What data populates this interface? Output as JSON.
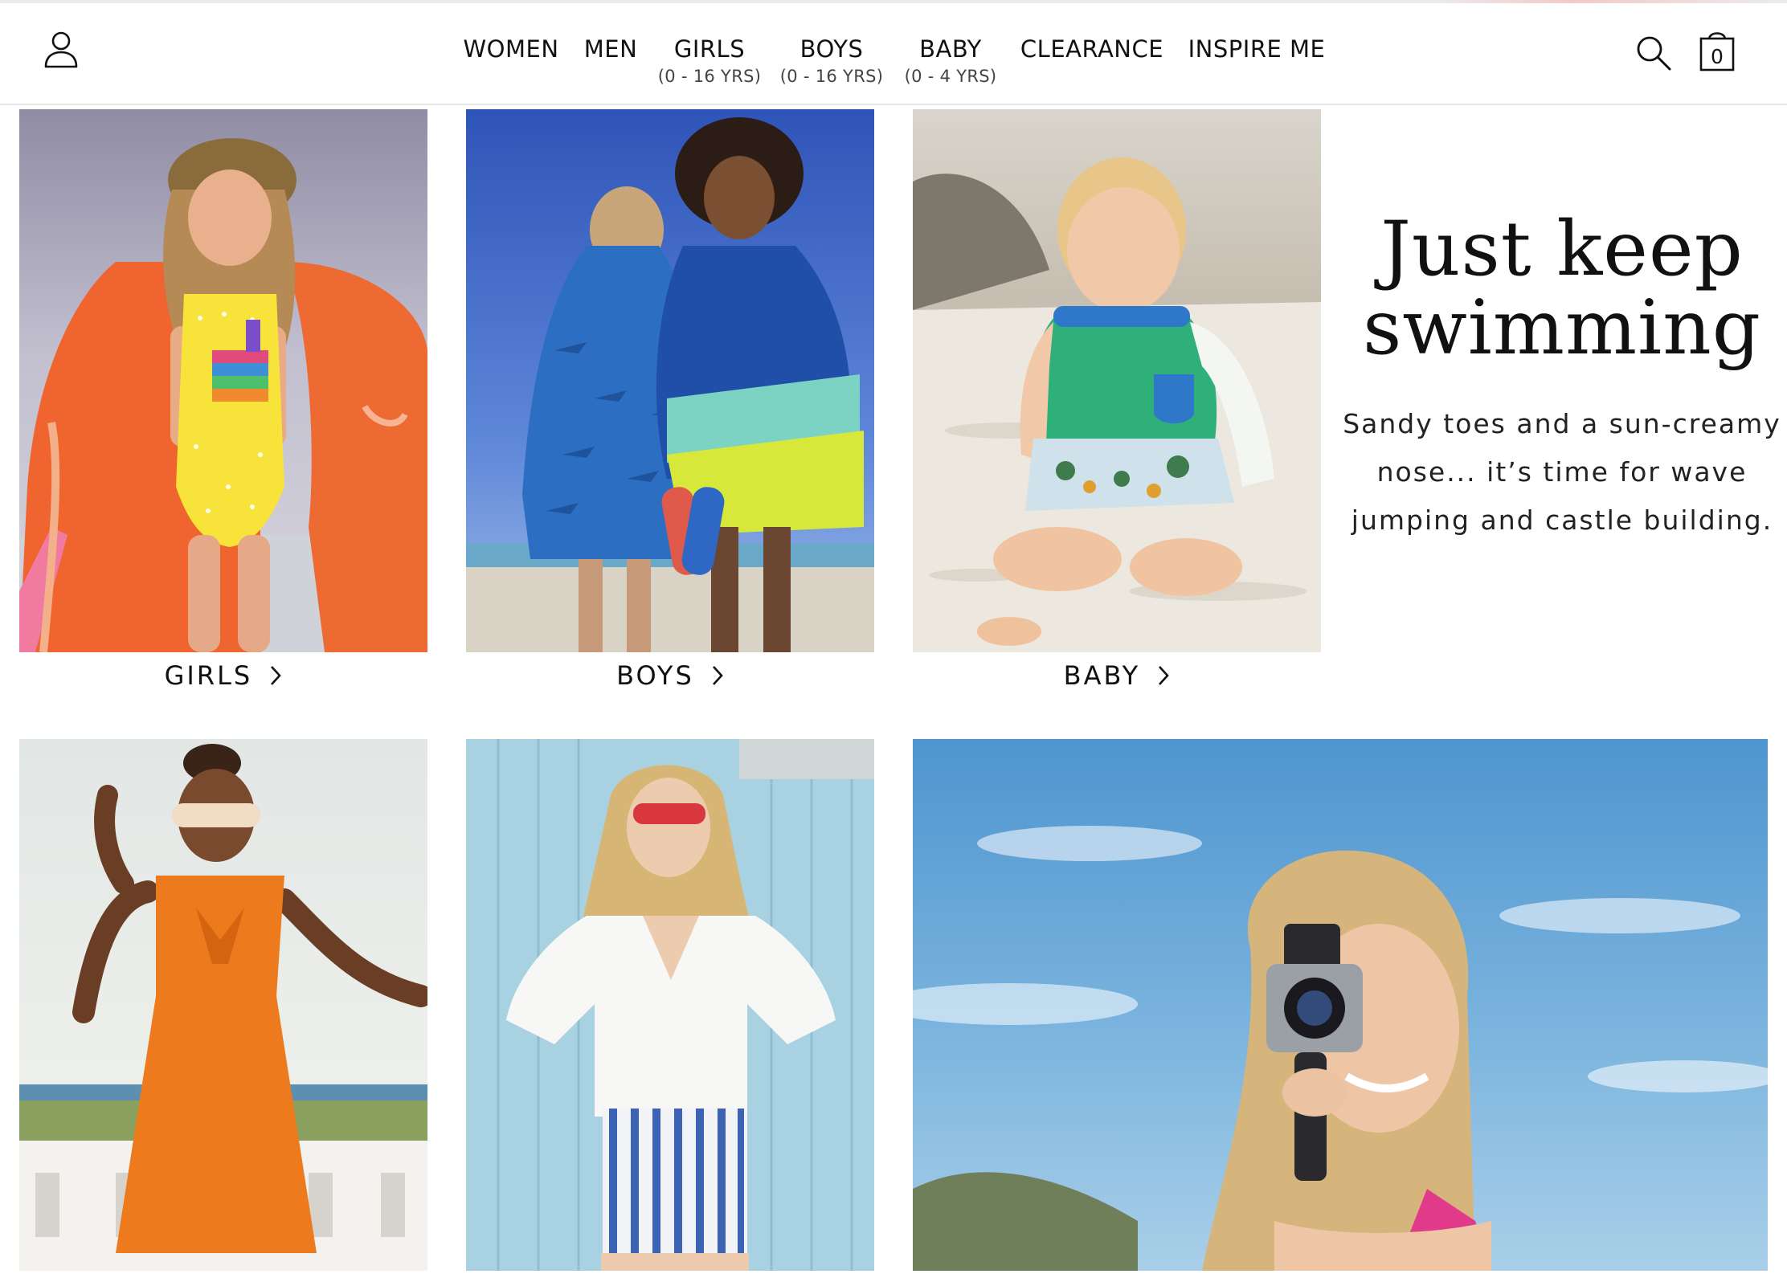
{
  "header": {
    "account_icon": "user-icon",
    "search_icon": "search-icon",
    "bag_icon": "shopping-bag-icon",
    "bag_count": "0",
    "nav": [
      {
        "label": "WOMEN",
        "sub": ""
      },
      {
        "label": "MEN",
        "sub": ""
      },
      {
        "label": "GIRLS",
        "sub": "(0 - 16 YRS)"
      },
      {
        "label": "BOYS",
        "sub": "(0 - 16 YRS)"
      },
      {
        "label": "BABY",
        "sub": "(0 - 4 YRS)"
      },
      {
        "label": "CLEARANCE",
        "sub": ""
      },
      {
        "label": "INSPIRE ME",
        "sub": ""
      }
    ]
  },
  "categories": [
    {
      "label": "GIRLS"
    },
    {
      "label": "BOYS"
    },
    {
      "label": "BABY"
    }
  ],
  "promo": {
    "title_line1": "Just keep",
    "title_line2": "swimming",
    "body": "Sandy toes and a sun-creamy nose... it’s time for wave jumping and castle building."
  },
  "colors": {
    "text": "#111111",
    "header_border": "#e6e6e6",
    "background": "#ffffff"
  }
}
